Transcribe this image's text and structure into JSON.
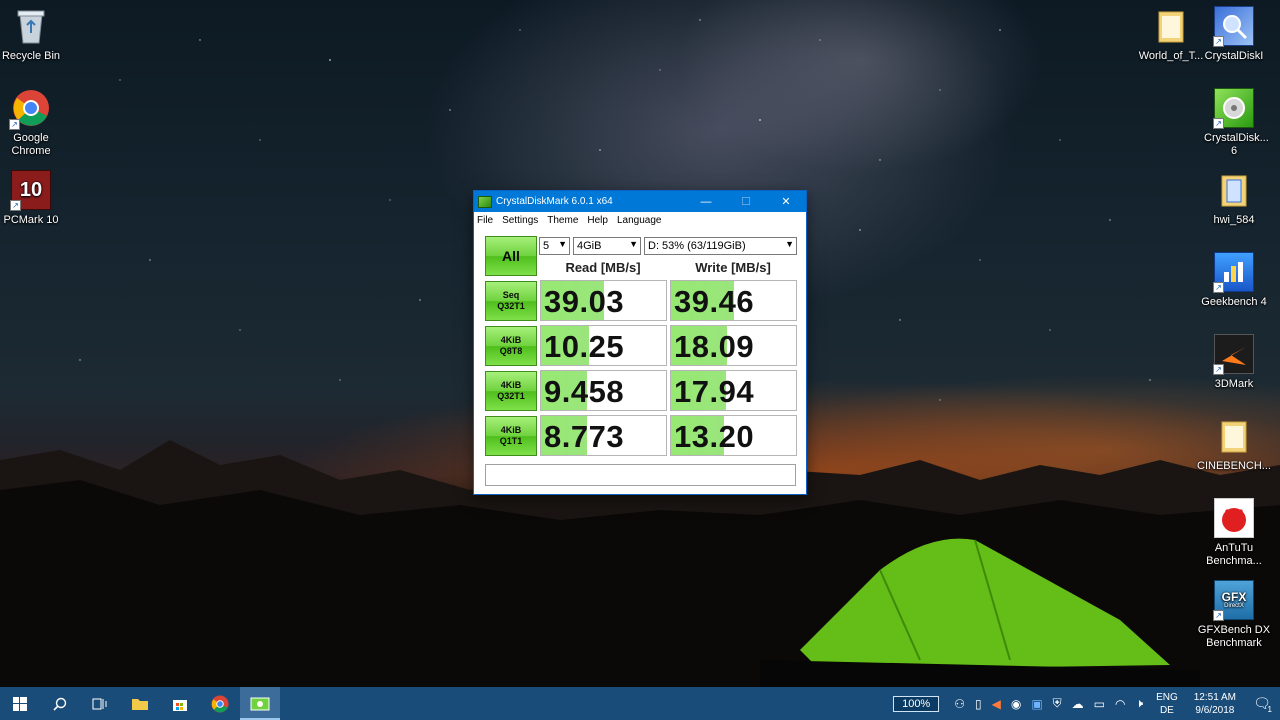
{
  "desktop": {
    "left_icons": [
      {
        "label": "Recycle Bin",
        "icon": "recycle-bin-icon"
      },
      {
        "label": "Google Chrome",
        "icon": "chrome-icon"
      },
      {
        "label": "PCMark 10",
        "icon": "pcmark-icon",
        "badge": "10"
      }
    ],
    "right_icons": [
      {
        "label": "World_of_T...",
        "icon": "folder-icon"
      },
      {
        "label": "CrystalDiskI",
        "icon": "crystaldiskinfo-icon"
      },
      {
        "label": "CrystalDisk... 6",
        "icon": "crystaldiskmark-icon"
      },
      {
        "label": "hwi_584",
        "icon": "folder-icon"
      },
      {
        "label": "Geekbench 4",
        "icon": "geekbench-icon"
      },
      {
        "label": "3DMark",
        "icon": "3dmark-icon"
      },
      {
        "label": "CINEBENCH...",
        "icon": "folder-icon"
      },
      {
        "label": "AnTuTu Benchma...",
        "icon": "antutu-icon"
      },
      {
        "label": "GFXBench DX Benchmark",
        "icon": "gfxbench-icon",
        "badge": "GFX",
        "badge_sub": "DirectX"
      }
    ]
  },
  "window": {
    "title": "CrystalDiskMark 6.0.1 x64",
    "menu": [
      "File",
      "Settings",
      "Theme",
      "Help",
      "Language"
    ],
    "all_button": "All",
    "count_select": "5",
    "size_select": "4GiB",
    "drive_select": "D: 53% (63/119GiB)",
    "read_header": "Read [MB/s]",
    "write_header": "Write [MB/s]",
    "rows": [
      {
        "line1": "Seq",
        "line2": "Q32T1",
        "read": "39.03",
        "write": "39.46",
        "read_fill": 0.5,
        "write_fill": 0.5
      },
      {
        "line1": "4KiB",
        "line2": "Q8T8",
        "read": "10.25",
        "write": "18.09",
        "read_fill": 0.38,
        "write_fill": 0.45
      },
      {
        "line1": "4KiB",
        "line2": "Q32T1",
        "read": "9.458",
        "write": "17.94",
        "read_fill": 0.37,
        "write_fill": 0.44
      },
      {
        "line1": "4KiB",
        "line2": "Q1T1",
        "read": "8.773",
        "write": "13.20",
        "read_fill": 0.37,
        "write_fill": 0.42
      }
    ],
    "comment": ""
  },
  "taskbar": {
    "zoom": "100%",
    "lang_top": "ENG",
    "lang_bottom": "DE",
    "time": "12:51 AM",
    "date": "9/6/2018",
    "notification_count": "1"
  }
}
